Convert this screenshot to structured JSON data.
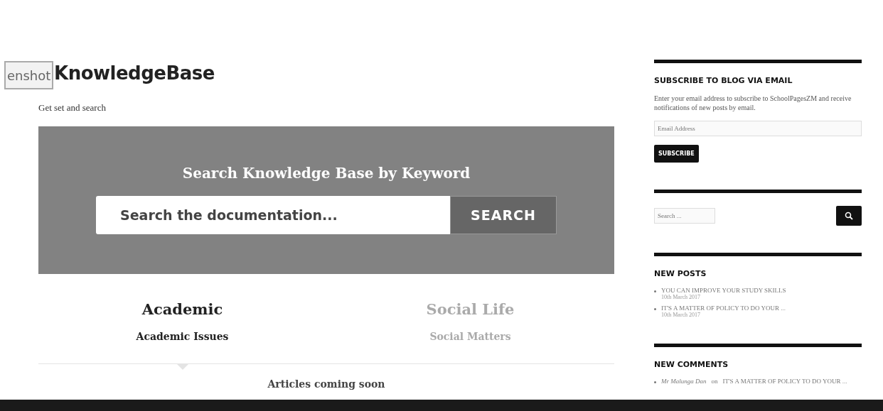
{
  "overlay_button": {
    "label": "enshot"
  },
  "site": {
    "title": "KnowledgeBase",
    "tagline": "Get set and search"
  },
  "hero": {
    "heading": "Search Knowledge Base by Keyword",
    "search": {
      "placeholder": "Search the documentation...",
      "button": "SEARCH"
    }
  },
  "tabs": [
    {
      "label": "Academic",
      "sublabel": "Academic Issues",
      "selected": true
    },
    {
      "label": "Social Life",
      "sublabel": "Social Matters",
      "selected": false
    }
  ],
  "tab_content": "Articles coming soon",
  "sidebar": {
    "subscribe": {
      "title": "SUBSCRIBE TO BLOG VIA EMAIL",
      "text": "Enter your email address to subscribe to SchoolPagesZM and receive notifications of new posts by email.",
      "placeholder": "Email Address",
      "button": "SUBSCRIBE"
    },
    "search": {
      "placeholder": "Search ..."
    },
    "new_posts": {
      "title": "NEW POSTS",
      "items": [
        {
          "title": "YOU CAN IMPROVE YOUR STUDY SKILLS",
          "date": "10th March 2017"
        },
        {
          "title": "IT'S A MATTER OF POLICY TO DO YOUR ...",
          "date": "10th March 2017"
        }
      ]
    },
    "new_comments": {
      "title": "NEW COMMENTS",
      "items": [
        {
          "author": "Mr Malunga Dan",
          "on": "on",
          "post": "IT'S A MATTER OF POLICY TO DO YOUR ..."
        }
      ]
    }
  }
}
